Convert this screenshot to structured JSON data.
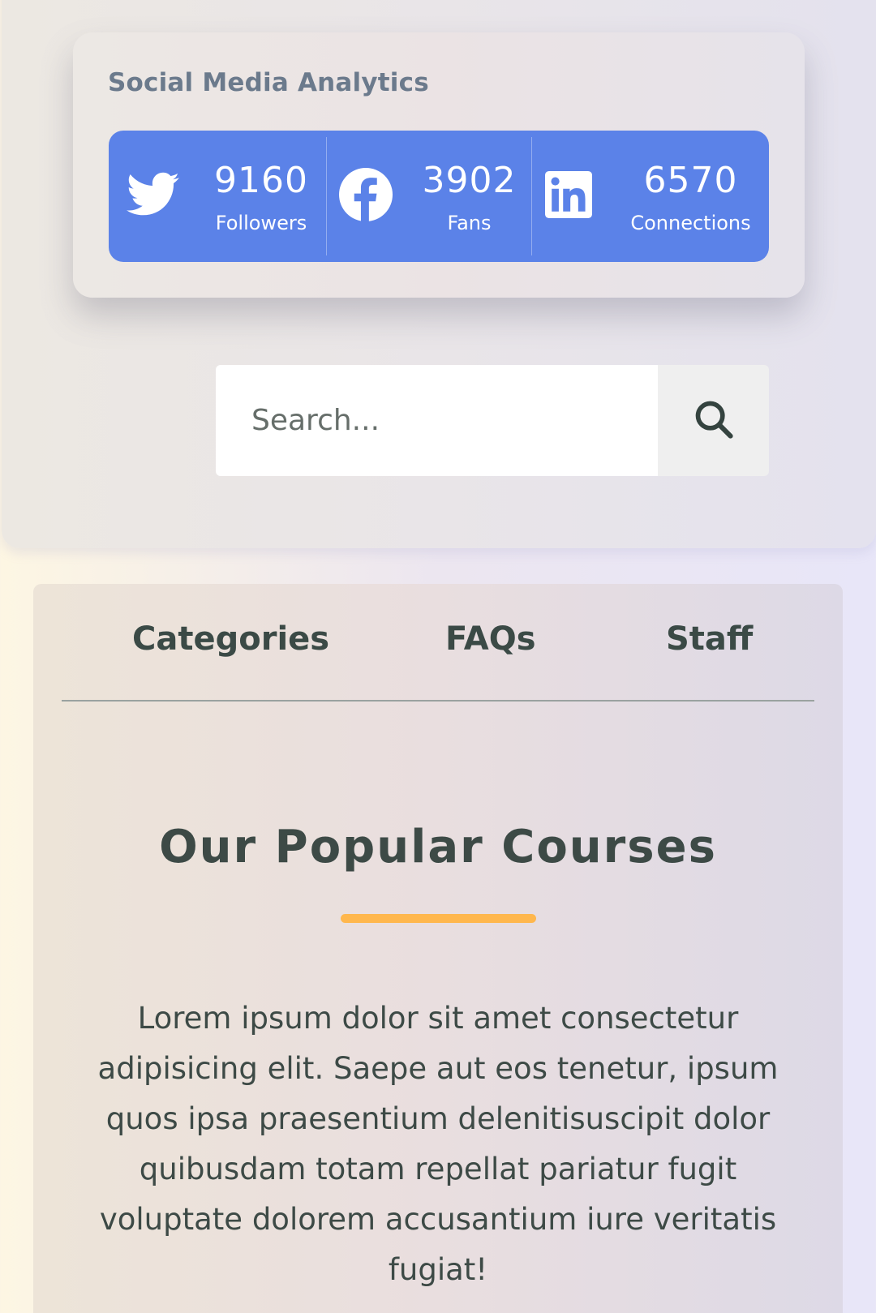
{
  "social": {
    "title": "Social Media Analytics",
    "accent_color": "#5b82e8",
    "stats": [
      {
        "icon": "twitter-icon",
        "value": "9160",
        "label": "Followers"
      },
      {
        "icon": "facebook-icon",
        "value": "3902",
        "label": "Fans"
      },
      {
        "icon": "linkedin-icon",
        "value": "6570",
        "label": "Connections"
      }
    ]
  },
  "search": {
    "placeholder": "Search...",
    "icon": "search-icon"
  },
  "tabs": [
    {
      "label": "Categories"
    },
    {
      "label": "FAQs"
    },
    {
      "label": "Staff"
    }
  ],
  "courses": {
    "title": "Our Popular Courses",
    "underline_color": "#ffb74d",
    "description": "Lorem ipsum dolor sit amet consectetur adipisicing elit. Saepe aut eos tenetur, ipsum quos ipsa praesentium delenitisuscipit dolor quibusdam totam repellat pariatur fugit voluptate dolorem accusantium iure veritatis fugiat!"
  }
}
